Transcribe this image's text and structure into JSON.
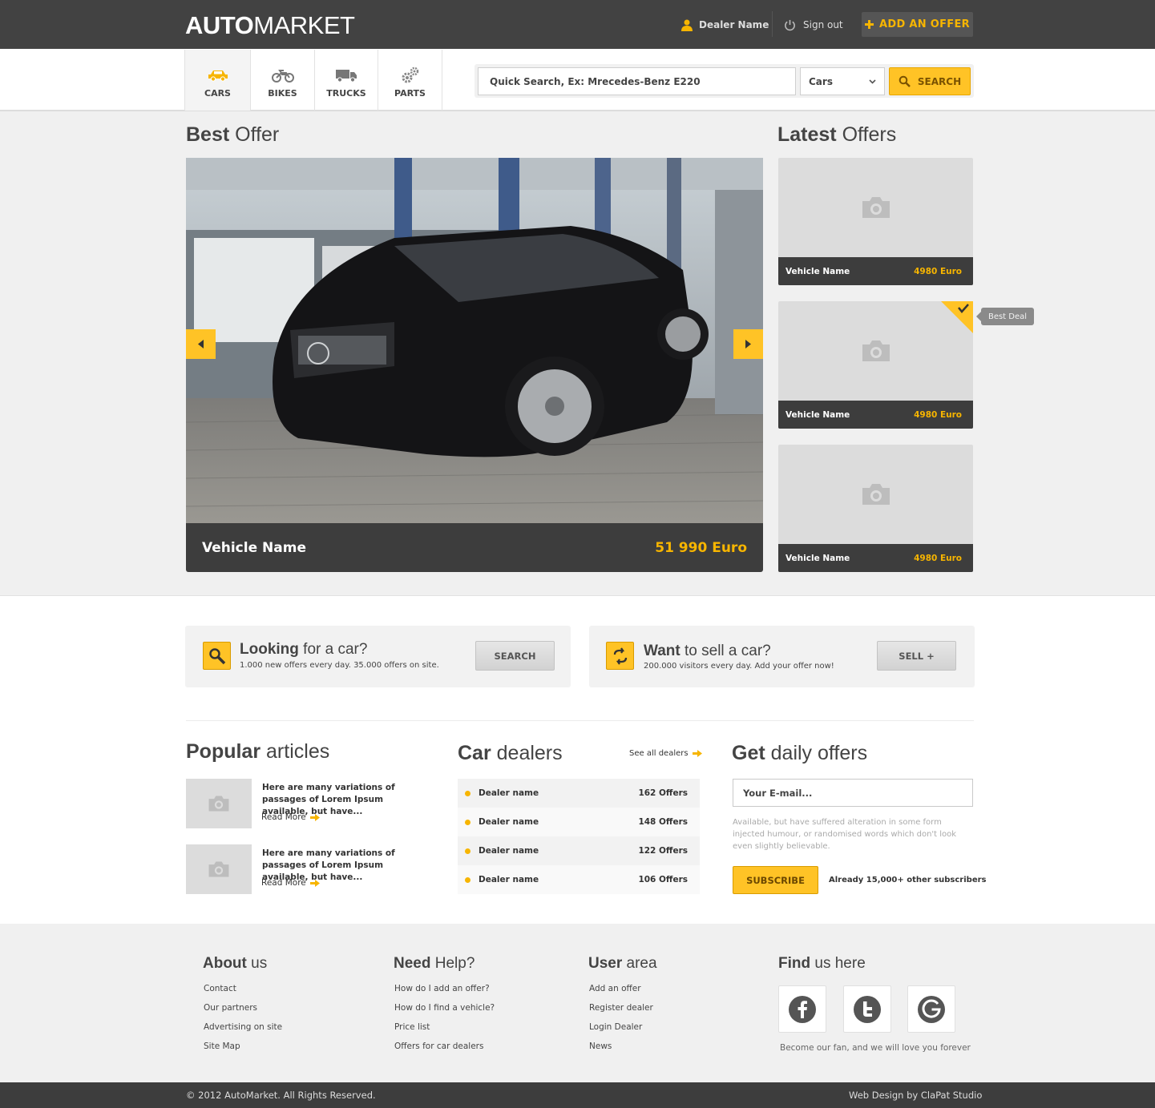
{
  "header": {
    "logo_bold": "AUTO",
    "logo_light": "MARKET",
    "dealer_name": "Dealer Name",
    "sign_out": "Sign out",
    "add_offer": "ADD AN OFFER",
    "icons": {
      "user": "user-icon",
      "power": "power-icon",
      "plus": "plus-icon"
    }
  },
  "nav": {
    "categories": [
      {
        "label": "CARS",
        "icon": "car-icon",
        "active": true
      },
      {
        "label": "BIKES",
        "icon": "motorbike-icon",
        "active": false
      },
      {
        "label": "TRUCKS",
        "icon": "truck-icon",
        "active": false
      },
      {
        "label": "PARTS",
        "icon": "gears-icon",
        "active": false
      }
    ],
    "search": {
      "placeholder": "Quick Search, Ex: Mrecedes-Benz E220",
      "category_selected": "Cars",
      "button": "SEARCH"
    }
  },
  "best_offer": {
    "title_bold": "Best",
    "title_light": "Offer",
    "vehicle_name": "Vehicle Name",
    "price": "51 990 Euro"
  },
  "latest_offers": {
    "title_bold": "Latest",
    "title_light": "Offers",
    "items": [
      {
        "name": "Vehicle Name",
        "price": "4980 Euro"
      },
      {
        "name": "Vehicle Name",
        "price": "4980 Euro",
        "badge": "Best Deal"
      },
      {
        "name": "Vehicle Name",
        "price": "4980 Euro"
      }
    ]
  },
  "promos": {
    "looking": {
      "title_bold": "Looking",
      "title_light": "for a car?",
      "subtitle": "1.000 new offers every day. 35.000 offers on site.",
      "button": "SEARCH"
    },
    "sell": {
      "title_bold": "Want",
      "title_light": "to sell a car?",
      "subtitle": "200.000 visitors every day. Add your offer now!",
      "button": "SELL +"
    }
  },
  "articles": {
    "title_bold": "Popular",
    "title_light": "articles",
    "items": [
      {
        "text": "Here are many variations of passages of Lorem Ipsum available, but have...",
        "read_more": "Read More"
      },
      {
        "text": "Here are many variations of passages of Lorem Ipsum available, but have...",
        "read_more": "Read More"
      }
    ]
  },
  "dealers": {
    "title_bold": "Car",
    "title_light": "dealers",
    "see_all": "See all dealers",
    "items": [
      {
        "name": "Dealer name",
        "offers": "162 Offers"
      },
      {
        "name": "Dealer name",
        "offers": "148 Offers"
      },
      {
        "name": "Dealer name",
        "offers": "122 Offers"
      },
      {
        "name": "Dealer name",
        "offers": "106 Offers"
      }
    ]
  },
  "newsletter": {
    "title_bold": "Get",
    "title_light": "daily offers",
    "email_placeholder": "Your E-mail...",
    "description": "Available, but have suffered alteration in some form injected humour, or randomised words which don't look even slightly believable.",
    "button": "SUBSCRIBE",
    "subscribers": "Already 15,000+ other subscribers"
  },
  "footer": {
    "about": {
      "title_bold": "About",
      "title_light": "us",
      "links": [
        "Contact",
        "Our partners",
        "Advertising on site",
        "Site Map"
      ]
    },
    "help": {
      "title_bold": "Need",
      "title_light": "Help?",
      "links": [
        "How do I add an offer?",
        "How do I find a vehicle?",
        "Price list",
        "Offers for car dealers"
      ]
    },
    "user": {
      "title_bold": "User",
      "title_light": "area",
      "links": [
        "Add an offer",
        "Register dealer",
        "Login Dealer",
        "News"
      ]
    },
    "find": {
      "title_bold": "Find",
      "title_light": "us here",
      "social": [
        "facebook-icon",
        "twitter-icon",
        "google-icon"
      ],
      "tagline": "Become our fan, and we will love you forever"
    },
    "copyright": "© 2012 AutoMarket. All Rights Reserved.",
    "credit": "Web Design by ClaPat Studio"
  },
  "colors": {
    "accent": "#ffc326",
    "dark": "#424242",
    "price": "#f7b500"
  }
}
